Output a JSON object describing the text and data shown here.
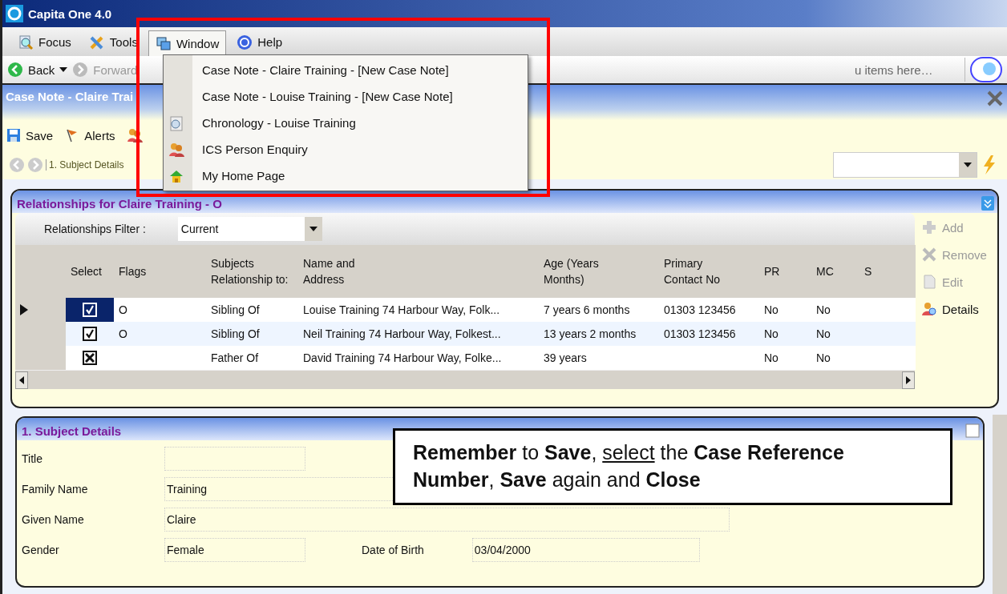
{
  "window": {
    "title": "Capita One 4.0"
  },
  "menu_bar": [
    {
      "label": "Focus",
      "kind": "focus",
      "selected": false
    },
    {
      "label": "Tools",
      "kind": "tools",
      "selected": false
    },
    {
      "label": "Window",
      "kind": "window",
      "selected": true
    },
    {
      "label": "Help",
      "kind": "help",
      "selected": false
    }
  ],
  "nav": {
    "back": "Back",
    "forward": "Forward",
    "search_text": "u items here…"
  },
  "window_menu": [
    {
      "label": "Case Note - Claire Training - [New Case Note]",
      "kind": "plain"
    },
    {
      "label": "Case Note - Louise Training - [New Case Note]",
      "kind": "plain"
    },
    {
      "label": "Chronology - Louise Training",
      "kind": "clock"
    },
    {
      "label": "ICS Person Enquiry",
      "kind": "people"
    },
    {
      "label": "My Home Page",
      "kind": "home"
    }
  ],
  "pane": {
    "title": "Case Note - Claire Trai",
    "toolbar": [
      {
        "label": "Save",
        "kind": "save"
      },
      {
        "label": "Alerts",
        "kind": "flag"
      },
      {
        "kind": "people"
      }
    ],
    "step": "1. Subject Details"
  },
  "relationships": {
    "title": "Relationships for Claire Training - O",
    "filter_label": "Relationships Filter :",
    "filter_value": "Current",
    "columns": [
      "Select",
      "Flags",
      "Subjects Relationship to:",
      "Name and Address",
      "Age (Years Months)",
      "Primary Contact No",
      "PR",
      "MC",
      "S"
    ],
    "rows": [
      {
        "selected": true,
        "kind": "tick",
        "flags": "O",
        "relationship": "Sibling Of",
        "name_address": "Louise Training 74 Harbour Way, Folk...",
        "age": "7 years 6 months",
        "contact": "01303 123456",
        "pr": "No",
        "mc": "No"
      },
      {
        "selected": false,
        "kind": "tick",
        "flags": "O",
        "relationship": "Sibling Of",
        "name_address": "Neil Training 74 Harbour Way, Folkest...",
        "age": "13 years 2 months",
        "contact": "01303 123456",
        "pr": "No",
        "mc": "No"
      },
      {
        "selected": false,
        "kind": "cross",
        "relationship": "Father Of",
        "name_address": "David Training 74 Harbour Way, Folke...",
        "age": "39 years",
        "pr": "No",
        "mc": "No"
      }
    ],
    "actions": [
      {
        "label": "Add",
        "kind": "plus",
        "disabled": true
      },
      {
        "label": "Remove",
        "kind": "cross",
        "disabled": true
      },
      {
        "label": "Edit",
        "kind": "page",
        "disabled": true
      },
      {
        "label": "Details",
        "kind": "person",
        "disabled": false
      }
    ]
  },
  "subject_details": {
    "title": "1. Subject Details",
    "fields": [
      {
        "label": "Title"
      },
      {
        "label": "Family Name",
        "value": "Training"
      },
      {
        "label": "Given Name",
        "value": "Claire"
      },
      {
        "label": "Gender",
        "value": "Female"
      }
    ],
    "date_of_birth": {
      "label": "Date of Birth",
      "value": "03/04/2000"
    }
  },
  "callout": [
    {
      "text": "Remember",
      "kind": "bold"
    },
    {
      "text": " to ",
      "kind": "plain"
    },
    {
      "text": "Save",
      "kind": "bold"
    },
    {
      "text": ", ",
      "kind": "plain"
    },
    {
      "text": "select",
      "kind": "underline"
    },
    {
      "text": " the ",
      "kind": "plain"
    },
    {
      "text": "Case Reference Number",
      "kind": "bold"
    },
    {
      "text": ", ",
      "kind": "plain"
    },
    {
      "text": "Save",
      "kind": "bold"
    },
    {
      "text": " again and ",
      "kind": "plain"
    },
    {
      "text": "Close",
      "kind": "bold"
    }
  ]
}
